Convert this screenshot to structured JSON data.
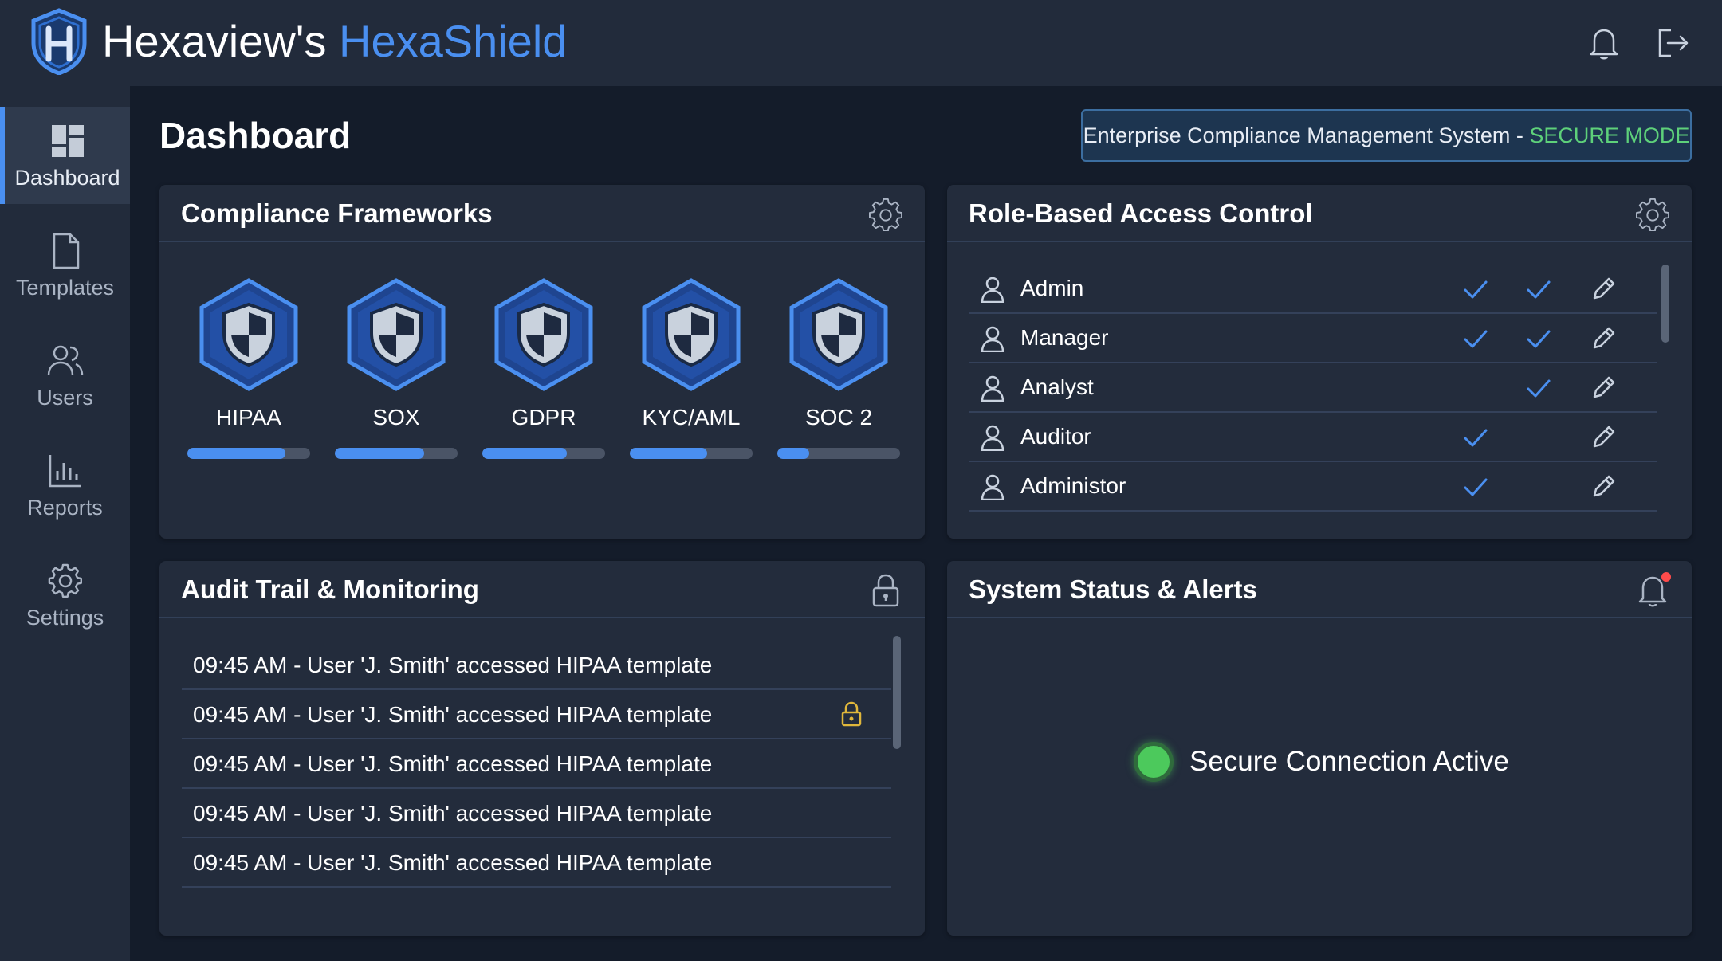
{
  "app": {
    "brand_prefix": "Hexaview's",
    "brand_product": "HexaShield",
    "logo_icon": "hexagon-h-logo-icon",
    "accent_color": "#4a8ff0",
    "success_color": "#5ed17a"
  },
  "header": {
    "notifications_icon": "bell-icon",
    "logout_icon": "logout-icon"
  },
  "sidebar": {
    "items": [
      {
        "label": "Dashboard",
        "icon": "dashboard-grid-icon",
        "active": true
      },
      {
        "label": "Templates",
        "icon": "document-icon",
        "active": false
      },
      {
        "label": "Users",
        "icon": "users-icon",
        "active": false
      },
      {
        "label": "Reports",
        "icon": "bar-chart-icon",
        "active": false
      },
      {
        "label": "Settings",
        "icon": "gear-icon",
        "active": false
      }
    ]
  },
  "main": {
    "title": "Dashboard",
    "mode_text": "Enterprise Compliance Management System - ",
    "mode_status": "SECURE MODE"
  },
  "frameworks": {
    "title": "Compliance Frameworks",
    "settings_icon": "gear-icon",
    "items": [
      {
        "name": "HIPAA",
        "progress": 0.8
      },
      {
        "name": "SOX",
        "progress": 0.73
      },
      {
        "name": "GDPR",
        "progress": 0.69
      },
      {
        "name": "KYC/AML",
        "progress": 0.63
      },
      {
        "name": "SOC 2",
        "progress": 0.26
      }
    ]
  },
  "rbac": {
    "title": "Role-Based Access Control",
    "settings_icon": "gear-icon",
    "roles": [
      {
        "name": "Admin",
        "perm1": true,
        "perm2": true
      },
      {
        "name": "Manager",
        "perm1": true,
        "perm2": true
      },
      {
        "name": "Analyst",
        "perm1": false,
        "perm2": true
      },
      {
        "name": "Auditor",
        "perm1": true,
        "perm2": false
      },
      {
        "name": "Administor",
        "perm1": true,
        "perm2": false
      }
    ]
  },
  "audit": {
    "title": "Audit Trail & Monitoring",
    "header_icon": "lock-icon",
    "entries": [
      {
        "text": "09:45 AM - User 'J. Smith' accessed HIPAA template",
        "locked": false
      },
      {
        "text": "09:45 AM - User 'J. Smith' accessed HIPAA template",
        "locked": true
      },
      {
        "text": "09:45 AM - User 'J. Smith' accessed HIPAA template",
        "locked": false
      },
      {
        "text": "09:45 AM - User 'J. Smith' accessed HIPAA template",
        "locked": false
      },
      {
        "text": "09:45 AM - User 'J. Smith' accessed HIPAA template",
        "locked": false
      }
    ]
  },
  "status": {
    "title": "System Status & Alerts",
    "header_icon": "bell-alert-icon",
    "connection_text": "Secure Connection Active",
    "connection_color": "#4cc95c"
  }
}
